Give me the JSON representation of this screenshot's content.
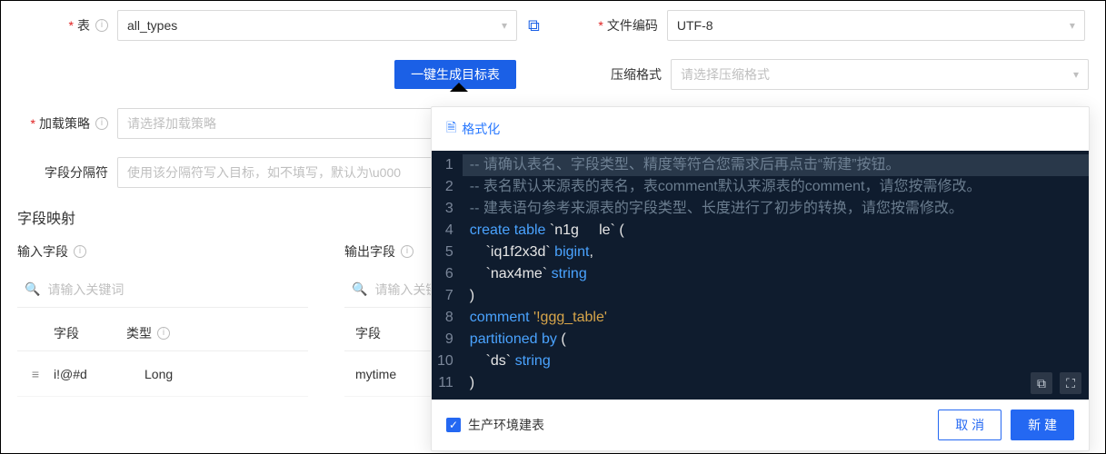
{
  "form": {
    "table_label": "表",
    "table_value": "all_types",
    "copy_tooltip": "copy",
    "gen_button": "一键生成目标表",
    "load_strategy_label": "加载策略",
    "load_strategy_placeholder": "请选择加载策略",
    "delimiter_label": "字段分隔符",
    "delimiter_placeholder": "使用该分隔符写入目标，如不填写，默认为\\u000",
    "encoding_label": "文件编码",
    "encoding_value": "UTF-8",
    "compress_label": "压缩格式",
    "compress_placeholder": "请选择压缩格式"
  },
  "mapping": {
    "title": "字段映射",
    "input_label": "输入字段",
    "output_label": "输出字段",
    "search_placeholder_in": "请输入关键词",
    "search_placeholder_out": "请输入关键",
    "head_field": "字段",
    "head_type": "类型",
    "row": {
      "field": "i!@#d",
      "type": "Long",
      "out_field": "mytime"
    }
  },
  "popover": {
    "format": "格式化",
    "checkbox": "生产环境建表",
    "cancel": "取 消",
    "create": "新 建",
    "copy_action": "copy",
    "fullscreen_action": "fullscreen",
    "code": {
      "l1": {
        "cm": "-- 请确认表名、字段类型、精度等符合您需求后再点击“新建”按钮。"
      },
      "l2": {
        "cm": "-- 表名默认来源表的表名，表comment默认来源表的comment，请您按需修改。"
      },
      "l3": {
        "cm": "-- 建表语句参考来源表的字段类型、长度进行了初步的转换，请您按需修改。"
      },
      "l4": {
        "kw1": "create",
        "kw2": "table",
        "name": "`n1g     le`",
        "paren": " ("
      },
      "l5": {
        "col": "    `iq1f2x3d`",
        "ty": " bigint",
        "comma": ","
      },
      "l6": {
        "col": "    `nax4me`",
        "ty": " string"
      },
      "l7": {
        "txt": ")"
      },
      "l8": {
        "kw": "comment ",
        "str": "'!ggg_table'"
      },
      "l9": {
        "kw": "partitioned by ",
        "paren": "("
      },
      "l10": {
        "col": "    `ds`",
        "ty": " string"
      },
      "l11": {
        "txt": ")"
      }
    }
  }
}
